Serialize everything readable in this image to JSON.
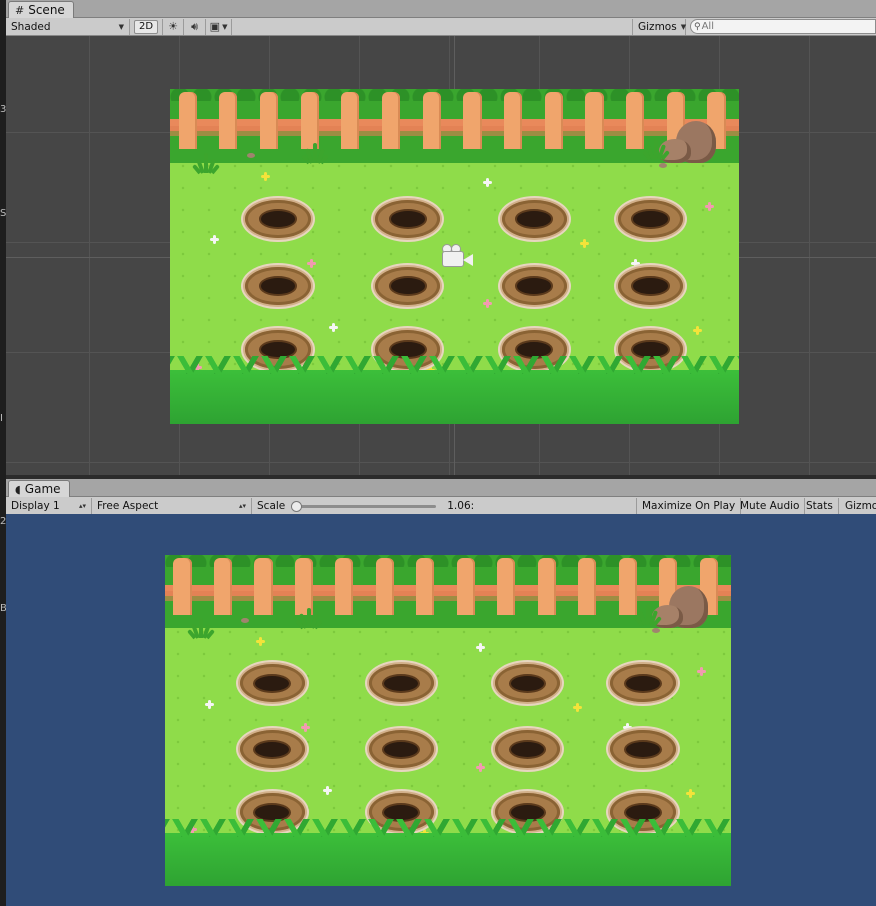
{
  "scene_tab": {
    "label": "Scene",
    "icon": "hash-icon"
  },
  "scene_toolbar": {
    "draw_mode": "Shaded",
    "mode_2d": "2D",
    "lighting_icon": "sun-icon",
    "audio_icon": "speaker-icon",
    "effects_icon": "image-icon",
    "gizmos": "Gizmos",
    "search_placeholder": "All"
  },
  "game_tab": {
    "label": "Game",
    "icon": "pacman-icon"
  },
  "game_toolbar": {
    "display": "Display 1",
    "aspect": "Free Aspect",
    "scale_label": "Scale",
    "scale_value": "1.06:",
    "maximize_on_play": "Maximize On Play",
    "mute_audio": "Mute Audio",
    "stats": "Stats",
    "gizmos": "Gizmo"
  },
  "left_strip_glyphs": [
    "3",
    "S",
    "I",
    "2",
    "B"
  ],
  "colors": {
    "scene_bg": "#464646",
    "game_bg": "#304c78",
    "grass": "#8fdc4a",
    "fence": "#f0a56c",
    "toolbar": "#cbcbcb"
  }
}
